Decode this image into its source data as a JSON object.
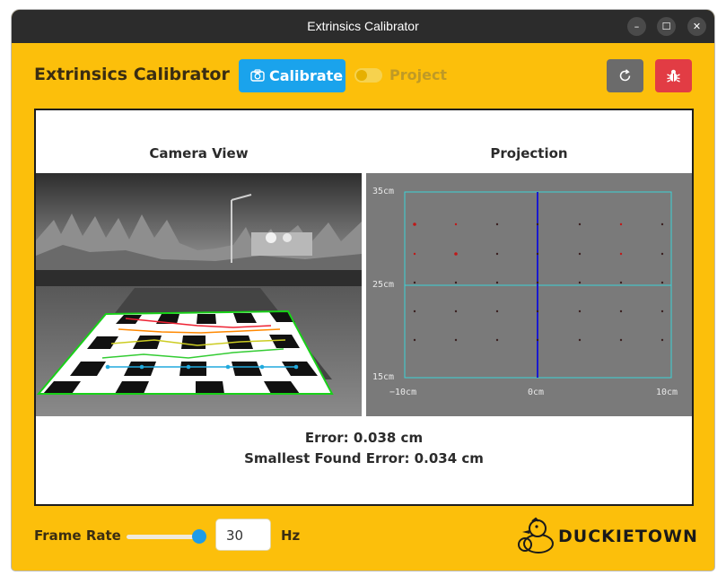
{
  "window": {
    "title": "Extrinsics Calibrator",
    "minimize_glyph": "–",
    "maximize_glyph": "☐",
    "close_glyph": "✕"
  },
  "header": {
    "app_title": "Extrinsics Calibrator",
    "calibrate_label": "Calibrate",
    "calibrate_icon": "camera-icon",
    "project_label": "Project",
    "project_toggle_on": false,
    "reset_icon": "refresh-icon",
    "debug_icon": "bug-icon"
  },
  "panel": {
    "camera_view_title": "Camera View",
    "projection_title": "Projection",
    "projection": {
      "y_labels": [
        "35cm",
        "25cm",
        "15cm"
      ],
      "x_labels": [
        "−10cm",
        "0cm",
        "10cm"
      ]
    },
    "error_text": "Error: 0.038 cm",
    "smallest_error_text": "Smallest Found Error: 0.034 cm"
  },
  "footer": {
    "frame_rate_label": "Frame Rate",
    "frame_rate_value": "30",
    "frame_rate_unit": "Hz",
    "frame_rate_slider_level": 0.93,
    "logo_text": "DUCKIETOWN"
  },
  "colors": {
    "background": "#fcbf0b",
    "titlebar": "#2c2c2c",
    "calibrate": "#1aa3ec",
    "reset": "#6b6b6b",
    "debug": "#e23c44",
    "projection_bg": "#7a7a7a",
    "projection_grid": "#3cd3d7",
    "projection_axis": "#1a1ad0"
  }
}
